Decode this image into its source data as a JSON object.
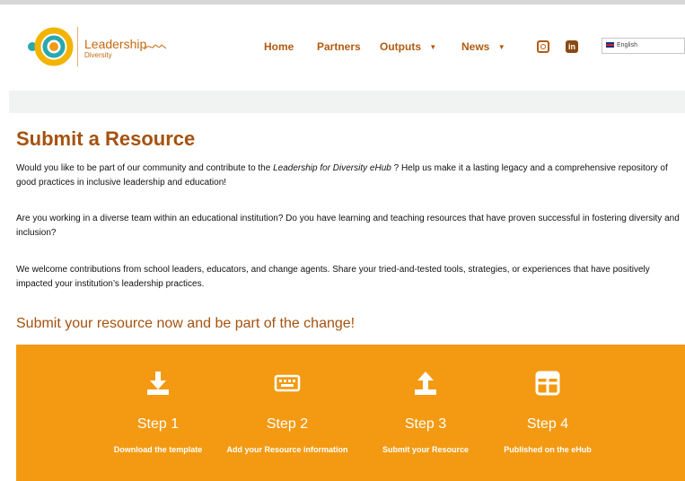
{
  "header": {
    "logo_title": "Leadership",
    "logo_subtitle": "Diversity",
    "nav": [
      {
        "label": "Home"
      },
      {
        "label": "Partners"
      },
      {
        "label": "Outputs",
        "dropdown": true
      },
      {
        "label": "News",
        "dropdown": true
      }
    ],
    "social": {
      "instagram_icon": "instagram-icon",
      "linkedin_icon": "linkedin-icon",
      "linkedin_text": "in"
    },
    "language": {
      "selected": "English",
      "flag": "uk-flag"
    }
  },
  "main": {
    "title": "Submit a Resource",
    "paragraphs": {
      "p1_before": "Would you like to be part of our community and contribute to the ",
      "p1_em": "Leadership for Diversity eHub",
      "p1_after": " ? Help us make it a lasting legacy and a comprehensive repository of good practices in inclusive leadership and education!",
      "p2": "Are you working in a diverse team within an educational institution? Do you have learning and teaching resources that have proven successful in fostering diversity and inclusion?",
      "p3": "We welcome contributions from school leaders, educators, and change agents. Share your tried-and-tested tools, strategies, or experiences that have positively impacted your institution’s leadership practices."
    },
    "cta": "Submit your resource now and be part of the change!",
    "steps": [
      {
        "icon": "download-icon",
        "title": "Step 1",
        "desc": "Download the template"
      },
      {
        "icon": "keyboard-icon",
        "title": "Step 2",
        "desc": "Add your Resource information"
      },
      {
        "icon": "upload-icon",
        "title": "Step 3",
        "desc": "Submit your Resource"
      },
      {
        "icon": "grid-icon",
        "title": "Step 4",
        "desc": "Published on the eHub"
      }
    ]
  },
  "colors": {
    "brand_orange": "#f39a12",
    "heading_brown": "#a5520f",
    "nav_brown": "#b25b10",
    "logo_teal": "#2aa7b0",
    "logo_yellow": "#f2b400"
  }
}
